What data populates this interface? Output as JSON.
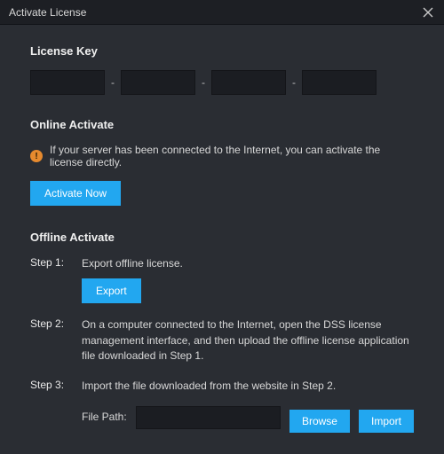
{
  "window": {
    "title": "Activate License"
  },
  "license_key": {
    "heading": "License Key",
    "segments": [
      "",
      "",
      "",
      ""
    ],
    "separator": "-"
  },
  "online": {
    "heading": "Online Activate",
    "warning_glyph": "!",
    "hint": "If your server has been connected to the Internet, you can activate the license directly.",
    "activate_label": "Activate Now"
  },
  "offline": {
    "heading": "Offline Activate",
    "step1": {
      "label": "Step 1:",
      "text": "Export offline license.",
      "button": "Export"
    },
    "step2": {
      "label": "Step 2:",
      "text": "On a computer connected to the Internet, open the DSS license management interface, and then upload the offline license application file downloaded in Step 1."
    },
    "step3": {
      "label": "Step 3:",
      "text": "Import the file downloaded from the website in Step 2.",
      "file_path_label": "File Path:",
      "file_path_value": "",
      "browse_label": "Browse",
      "import_label": "Import"
    }
  }
}
